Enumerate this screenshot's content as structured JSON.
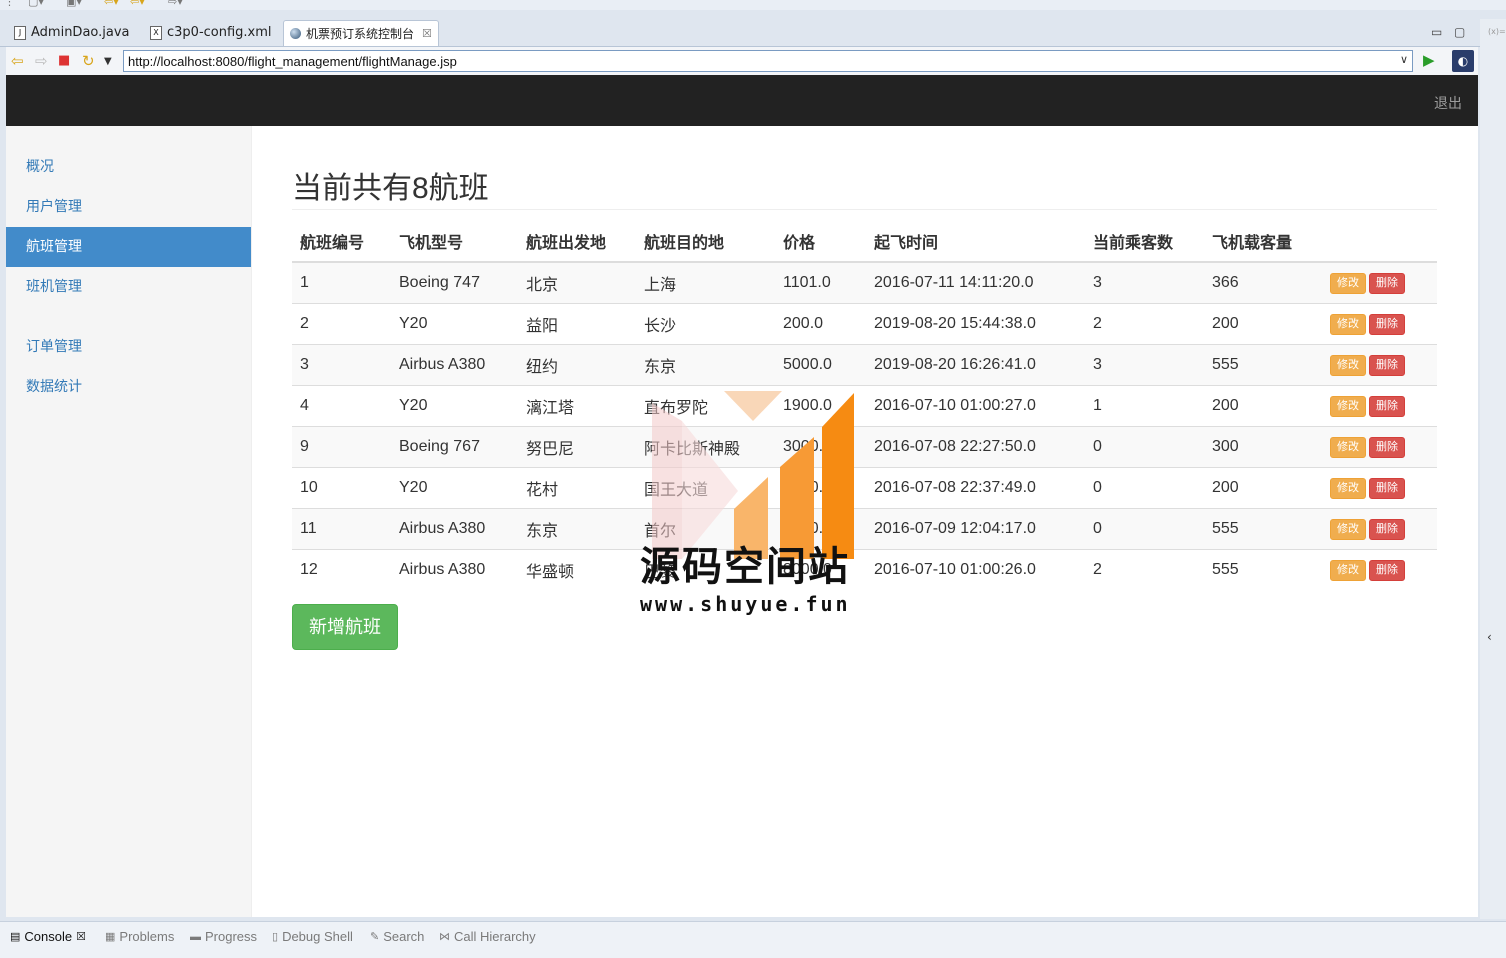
{
  "ide": {
    "tabs": [
      {
        "label": "AdminDao.java",
        "icon": "java-file-icon"
      },
      {
        "label": "c3p0-config.xml",
        "icon": "xml-file-icon"
      },
      {
        "label": "机票预订系统控制台",
        "icon": "globe-icon",
        "active": true
      }
    ],
    "bottom_tabs": [
      {
        "label": "Console",
        "active": true
      },
      {
        "label": "Problems"
      },
      {
        "label": "Progress"
      },
      {
        "label": "Debug Shell"
      },
      {
        "label": "Search"
      },
      {
        "label": "Call Hierarchy"
      }
    ],
    "right_label": "(x)="
  },
  "browser": {
    "url": "http://localhost:8080/flight_management/flightManage.jsp"
  },
  "topnav": {
    "logout_label": "退出"
  },
  "sidebar": {
    "items": [
      {
        "label": "概况"
      },
      {
        "label": "用户管理"
      },
      {
        "label": "航班管理",
        "active": true
      },
      {
        "label": "班机管理"
      },
      {
        "label": "订单管理"
      },
      {
        "label": "数据统计"
      }
    ]
  },
  "main": {
    "title": "当前共有8航班",
    "columns": [
      "航班编号",
      "飞机型号",
      "航班出发地",
      "航班目的地",
      "价格",
      "起飞时间",
      "当前乘客数",
      "飞机载客量"
    ],
    "edit_label": "修改",
    "delete_label": "删除",
    "rows": [
      [
        "1",
        "Boeing 747",
        "北京",
        "上海",
        "1101.0",
        "2016-07-11 14:11:20.0",
        "3",
        "366"
      ],
      [
        "2",
        "Y20",
        "益阳",
        "长沙",
        "200.0",
        "2019-08-20 15:44:38.0",
        "2",
        "200"
      ],
      [
        "3",
        "Airbus A380",
        "纽约",
        "东京",
        "5000.0",
        "2019-08-20 16:26:41.0",
        "3",
        "555"
      ],
      [
        "4",
        "Y20",
        "漓江塔",
        "直布罗陀",
        "1900.0",
        "2016-07-10 01:00:27.0",
        "1",
        "200"
      ],
      [
        "9",
        "Boeing 767",
        "努巴尼",
        "阿卡比斯神殿",
        "3000.0",
        "2016-07-08 22:27:50.0",
        "0",
        "300"
      ],
      [
        "10",
        "Y20",
        "花村",
        "国王大道",
        "1500.0",
        "2016-07-08 22:37:49.0",
        "0",
        "200"
      ],
      [
        "11",
        "Airbus A380",
        "东京",
        "首尔",
        "5500.0",
        "2016-07-09 12:04:17.0",
        "0",
        "555"
      ],
      [
        "12",
        "Airbus A380",
        "华盛顿",
        "巴黎",
        "8000.0",
        "2016-07-10 01:00:26.0",
        "2",
        "555"
      ]
    ],
    "add_label": "新增航班"
  },
  "watermark": {
    "title": "源码空间站",
    "url": "www.shuyue.fun"
  },
  "colors": {
    "navbar": "#222222",
    "sidebar_active": "#428bca",
    "edit_button": "#f0ad4e",
    "delete_button": "#d9534f",
    "add_button": "#5cb85c"
  }
}
